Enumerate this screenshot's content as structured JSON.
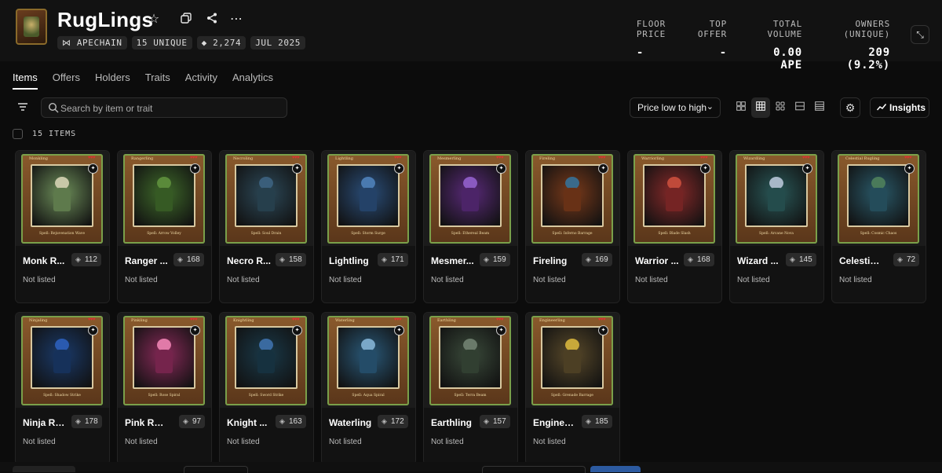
{
  "collection": {
    "title": "RugLings",
    "tags": [
      "⋈ APECHAIN",
      "15 UNIQUE",
      "2,274",
      "JUL 2025"
    ]
  },
  "stats": [
    {
      "label": "FLOOR PRICE",
      "value": "-"
    },
    {
      "label": "TOP OFFER",
      "value": "-"
    },
    {
      "label": "TOTAL VOLUME",
      "value": "0.00 APE"
    },
    {
      "label": "OWNERS (UNIQUE)",
      "value": "209 (9.2%)"
    }
  ],
  "tabs": [
    "Items",
    "Offers",
    "Holders",
    "Traits",
    "Activity",
    "Analytics"
  ],
  "active_tab": "Items",
  "search": {
    "placeholder": "Search by item or trait"
  },
  "sort": {
    "selected": "Price low to high"
  },
  "insights_label": "Insights",
  "items_count": "15 ITEMS",
  "colors": {
    "accent": "#2c5aa0",
    "background": "#0c0c0c",
    "card": "#121212"
  },
  "items": [
    {
      "name": "Monk R...",
      "card_title": "Monkling",
      "spell": "Spell: Rejuvenation Wave",
      "supply": "112",
      "status": "Not listed",
      "tint": "#6e8f5a",
      "skin": "#c8c8a8"
    },
    {
      "name": "Ranger ...",
      "card_title": "Rangerling",
      "spell": "Spell: Arrow Volley",
      "supply": "168",
      "status": "Not listed",
      "tint": "#3f6a2a",
      "skin": "#5a8a3a"
    },
    {
      "name": "Necro R...",
      "card_title": "Necroling",
      "spell": "Spell: Soul Drain",
      "supply": "158",
      "status": "Not listed",
      "tint": "#2d4a5a",
      "skin": "#3a5e7a"
    },
    {
      "name": "Lightling",
      "card_title": "Lightling",
      "spell": "Spell: Storm Surge",
      "supply": "171",
      "status": "Not listed",
      "tint": "#2a4e7a",
      "skin": "#4a7ab0"
    },
    {
      "name": "Mesmer...",
      "card_title": "Mesmerling",
      "spell": "Spell: Ethereal Beam",
      "supply": "159",
      "status": "Not listed",
      "tint": "#5a2a7a",
      "skin": "#8a5ac0"
    },
    {
      "name": "Fireling",
      "card_title": "Fireling",
      "spell": "Spell: Inferno Barrage",
      "supply": "169",
      "status": "Not listed",
      "tint": "#7a3a1a",
      "skin": "#3a6a8a"
    },
    {
      "name": "Warrior ...",
      "card_title": "Warriorling",
      "spell": "Spell: Blade Slash",
      "supply": "168",
      "status": "Not listed",
      "tint": "#8a2a2a",
      "skin": "#c04a3a"
    },
    {
      "name": "Wizard ...",
      "card_title": "Wizardling",
      "spell": "Spell: Arcane Nova",
      "supply": "145",
      "status": "Not listed",
      "tint": "#2a5a5a",
      "skin": "#a8b8c8"
    },
    {
      "name": "Celestial ...",
      "card_title": "Celestial Rugling",
      "spell": "Spell: Cosmic Chaos",
      "supply": "72",
      "status": "Not listed",
      "tint": "#2a5a6a",
      "skin": "#4a7a5a"
    },
    {
      "name": "Ninja Ru...",
      "card_title": "Ninjaling",
      "spell": "Spell: Shadow Strike",
      "supply": "178",
      "status": "Not listed",
      "tint": "#1a3a6a",
      "skin": "#2a5ab0"
    },
    {
      "name": "Pink Rugl...",
      "card_title": "Pinkling",
      "spell": "Spell: Rose Spiral",
      "supply": "97",
      "status": "Not listed",
      "tint": "#8a2a5a",
      "skin": "#e07aa8"
    },
    {
      "name": "Knight ...",
      "card_title": "Knightling",
      "spell": "Spell: Sword Strike",
      "supply": "163",
      "status": "Not listed",
      "tint": "#1a3a4a",
      "skin": "#3a6aa0"
    },
    {
      "name": "Waterling",
      "card_title": "Waterling",
      "spell": "Spell: Aqua Spiral",
      "supply": "172",
      "status": "Not listed",
      "tint": "#2a5a7a",
      "skin": "#7aa8c8"
    },
    {
      "name": "Earthling",
      "card_title": "Earthling",
      "spell": "Spell: Terra Beam",
      "supply": "157",
      "status": "Not listed",
      "tint": "#3a4a3a",
      "skin": "#6a7a6a"
    },
    {
      "name": "Enginee...",
      "card_title": "Engineerling",
      "spell": "Spell: Grenade Barrage",
      "supply": "185",
      "status": "Not listed",
      "tint": "#5a4a2a",
      "skin": "#c8a83a"
    }
  ]
}
